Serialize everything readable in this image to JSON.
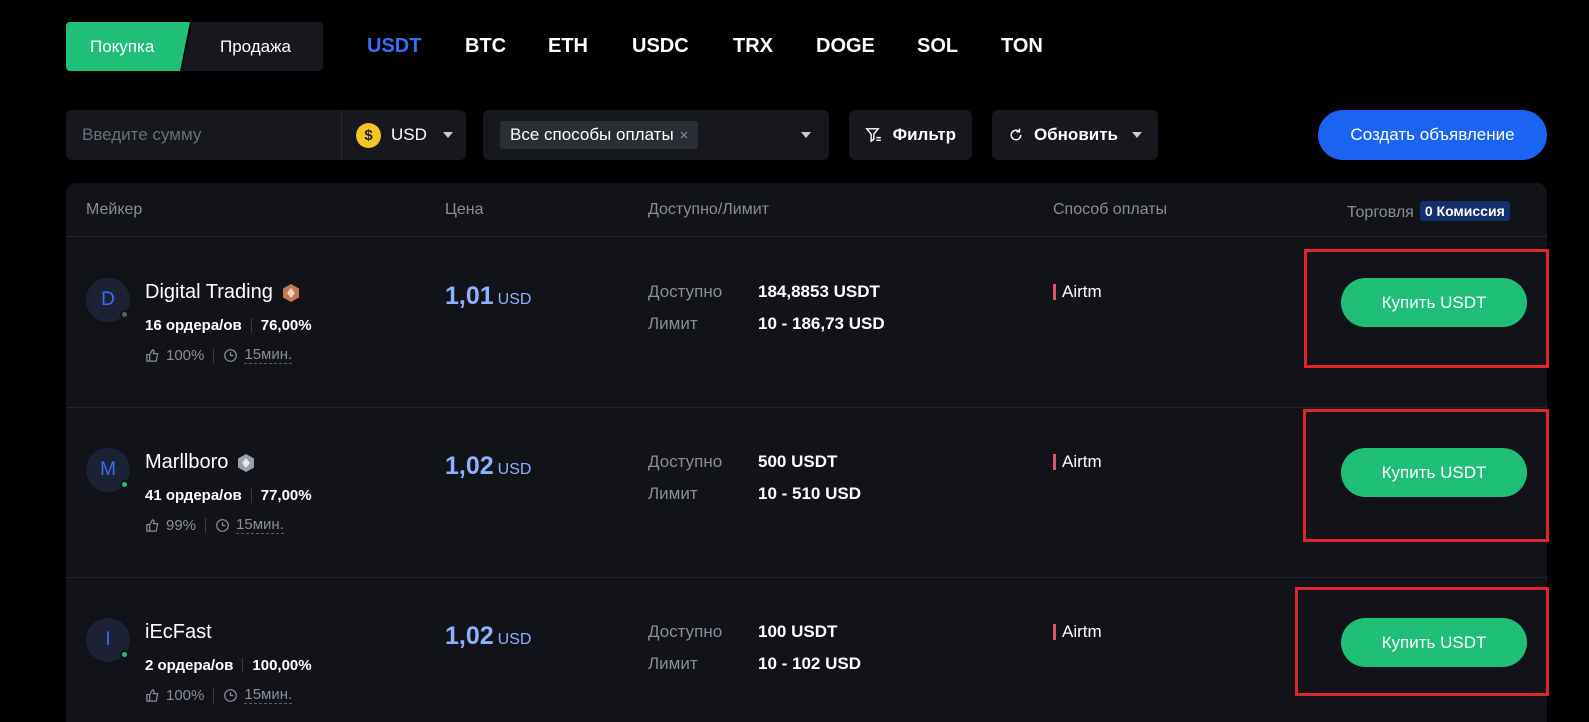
{
  "side_tabs": {
    "buy": "Покупка",
    "sell": "Продажа"
  },
  "coins": [
    "USDT",
    "BTC",
    "ETH",
    "USDC",
    "TRX",
    "DOGE",
    "SOL",
    "TON"
  ],
  "active_coin": "USDT",
  "filters": {
    "amount_placeholder": "Введите сумму",
    "currency_symbol": "$",
    "currency": "USD",
    "payment_chip": "Все способы оплаты",
    "chip_close": "×",
    "filter_label": "Фильтр",
    "refresh_label": "Обновить",
    "create_label": "Создать объявление"
  },
  "table": {
    "headers": {
      "maker": "Мейкер",
      "price": "Цена",
      "available": "Доступно/Лимит",
      "payment": "Способ оплаты",
      "trade": "Торговля",
      "fee_badge": "0 Комиссия"
    },
    "rows": [
      {
        "initial": "D",
        "name": "Digital Trading",
        "online": false,
        "orders": "16 ордера/ов",
        "completion": "76,00%",
        "like": "100%",
        "time": "15мин.",
        "price": "1,01",
        "price_currency": "USD",
        "avail_label": "Доступно",
        "avail_value": "184,8853 USDT",
        "limit_label": "Лимит",
        "limit_value": "10 - 186,73 USD",
        "payment": "Airtm",
        "buy_label": "Купить USDT"
      },
      {
        "initial": "M",
        "name": "Marllboro",
        "online": true,
        "orders": "41 ордера/ов",
        "completion": "77,00%",
        "like": "99%",
        "time": "15мин.",
        "price": "1,02",
        "price_currency": "USD",
        "avail_label": "Доступно",
        "avail_value": "500 USDT",
        "limit_label": "Лимит",
        "limit_value": "10 - 510 USD",
        "payment": "Airtm",
        "buy_label": "Купить USDT"
      },
      {
        "initial": "I",
        "name": "iEcFast",
        "online": true,
        "orders": "2 ордера/ов",
        "completion": "100,00%",
        "like": "100%",
        "time": "15мин.",
        "price": "1,02",
        "price_currency": "USD",
        "avail_label": "Доступно",
        "avail_value": "100 USDT",
        "limit_label": "Лимит",
        "limit_value": "10 - 102 USD",
        "payment": "Airtm",
        "buy_label": "Купить USDT"
      }
    ]
  },
  "colors": {
    "green": "#1fbf78",
    "blue": "#1b64f2",
    "active_coin": "#3b6cf6",
    "price": "#8fb1ff",
    "highlight": "#e0242b",
    "online": "#1fbf78",
    "offline": "#5a5e66"
  }
}
